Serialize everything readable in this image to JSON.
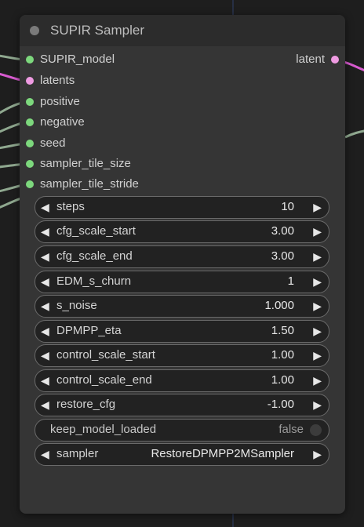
{
  "colors": {
    "canvas": "#1e1e1e",
    "node_body": "#353535",
    "node_header": "#2c2c2c",
    "slot_green": "#7dd87d",
    "slot_pink": "#ef9be2",
    "link_green": "#8fa88f",
    "link_pink": "#d85bd0"
  },
  "node": {
    "title": "SUPIR Sampler",
    "inputs": [
      {
        "name": "SUPIR_model",
        "color": "#7dd87d"
      },
      {
        "name": "latents",
        "color": "#ef9be2"
      },
      {
        "name": "positive",
        "color": "#7dd87d"
      },
      {
        "name": "negative",
        "color": "#7dd87d"
      },
      {
        "name": "seed",
        "color": "#7dd87d"
      },
      {
        "name": "sampler_tile_size",
        "color": "#7dd87d"
      },
      {
        "name": "sampler_tile_stride",
        "color": "#7dd87d"
      }
    ],
    "outputs": [
      {
        "name": "latent",
        "color": "#ef9be2"
      }
    ],
    "widgets": [
      {
        "label": "steps",
        "value": "10"
      },
      {
        "label": "cfg_scale_start",
        "value": "3.00"
      },
      {
        "label": "cfg_scale_end",
        "value": "3.00"
      },
      {
        "label": "EDM_s_churn",
        "value": "1"
      },
      {
        "label": "s_noise",
        "value": "1.000"
      },
      {
        "label": "DPMPP_eta",
        "value": "1.50"
      },
      {
        "label": "control_scale_start",
        "value": "1.00"
      },
      {
        "label": "control_scale_end",
        "value": "1.00"
      },
      {
        "label": "restore_cfg",
        "value": "-1.00"
      }
    ],
    "toggle": {
      "label": "keep_model_loaded",
      "value": "false"
    },
    "combo": {
      "label": "sampler",
      "value": "RestoreDPMPP2MSampler"
    },
    "arrow_left": "◀",
    "arrow_right": "▶"
  }
}
